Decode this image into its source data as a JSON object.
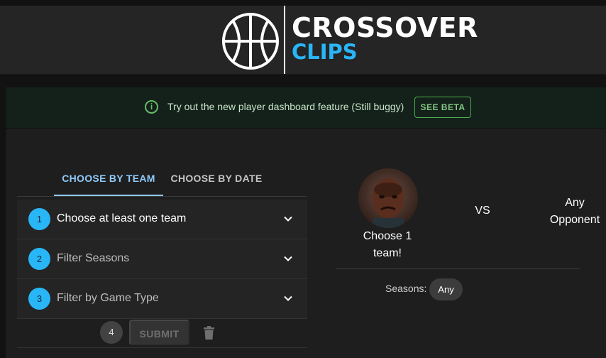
{
  "header": {
    "logo_word1": "CROSSOVER",
    "logo_word2": "CLIPS",
    "logo_icon": "basketball-icon",
    "accent_color": "#29b6f6"
  },
  "banner": {
    "icon": "info-icon",
    "icon_glyph": "i",
    "text": "Try out the new player dashboard feature (Still buggy)",
    "button_label": "SEE BETA",
    "color": "#66bb6a"
  },
  "tabs": [
    {
      "label": "CHOOSE BY TEAM",
      "active": true
    },
    {
      "label": "CHOOSE BY DATE",
      "active": false
    }
  ],
  "steps": [
    {
      "number": "1",
      "label": "Choose at least one team"
    },
    {
      "number": "2",
      "label": "Filter Seasons"
    },
    {
      "number": "3",
      "label": "Filter by Game Type"
    }
  ],
  "submit": {
    "step_number": "4",
    "label": "SUBMIT",
    "delete_icon": "trash-icon"
  },
  "matchup": {
    "team_caption": "Choose 1 team!",
    "vs_label": "VS",
    "opponent_label": "Any Opponent",
    "seasons_label": "Seasons:",
    "seasons_chip": "Any"
  }
}
